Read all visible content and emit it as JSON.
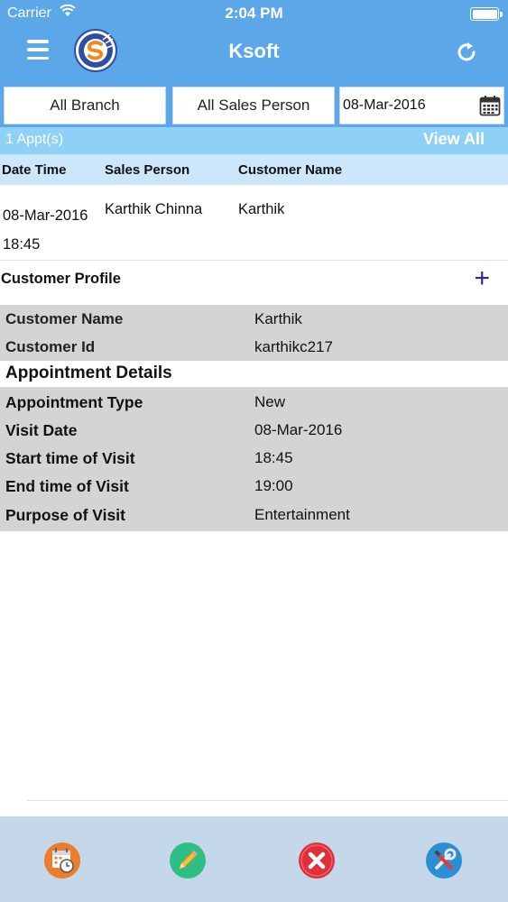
{
  "status_bar": {
    "carrier": "Carrier",
    "time": "2:04 PM"
  },
  "nav": {
    "title": "Ksoft"
  },
  "filters": {
    "branch": "All Branch",
    "sales_person": "All Sales Person",
    "date": "08-Mar-2016"
  },
  "summary": {
    "count": "1 Appt(s)",
    "view_all": "View All"
  },
  "columns": {
    "date_time": "Date Time",
    "sales_person": "Sales Person",
    "customer_name": "Customer Name"
  },
  "appointment": {
    "date": "08-Mar-2016",
    "time": "18:45",
    "sales_person": "Karthik Chinna",
    "customer": "Karthik"
  },
  "customer_profile": {
    "title": "Customer Profile",
    "add": "+",
    "fields": [
      {
        "label": "Customer Name",
        "value": "Karthik"
      },
      {
        "label": "Customer Id",
        "value": "karthikc217"
      }
    ]
  },
  "appointment_details": {
    "title": "Appointment Details",
    "fields": [
      {
        "label": "Appointment Type",
        "value": "New"
      },
      {
        "label": "Visit Date",
        "value": "08-Mar-2016"
      },
      {
        "label": "Start time of Visit",
        "value": "18:45"
      },
      {
        "label": "End time of Visit",
        "value": "19:00"
      },
      {
        "label": "Purpose of Visit",
        "value": "Entertainment"
      }
    ]
  },
  "tab_icons": [
    "calendar-clock-icon",
    "pencil-icon",
    "close-icon",
    "tools-icon"
  ],
  "colors": {
    "nav": "#5ba7e7",
    "count_bar": "#8fd0f6",
    "header": "#cce7fb",
    "gray_rows": "#d4d4d6",
    "tab_bar": "#c5d8ea"
  }
}
